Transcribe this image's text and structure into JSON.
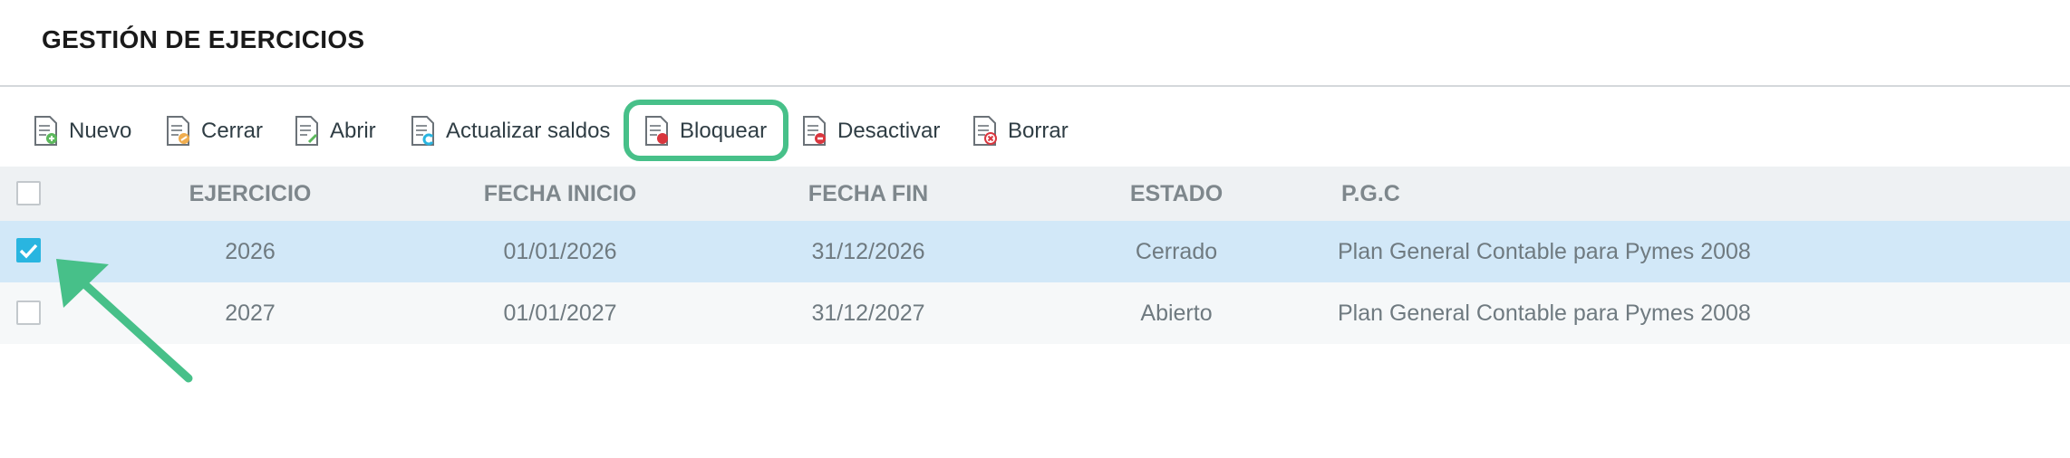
{
  "page_title": "GESTIÓN DE EJERCICIOS",
  "toolbar": {
    "buttons": [
      {
        "label": "Nuevo",
        "icon": "document-add-icon"
      },
      {
        "label": "Cerrar",
        "icon": "document-close-icon"
      },
      {
        "label": "Abrir",
        "icon": "document-open-icon"
      },
      {
        "label": "Actualizar saldos",
        "icon": "document-refresh-icon"
      },
      {
        "label": "Bloquear",
        "icon": "document-lock-icon"
      },
      {
        "label": "Desactivar",
        "icon": "document-deactivate-icon"
      },
      {
        "label": "Borrar",
        "icon": "document-delete-icon"
      }
    ]
  },
  "table": {
    "columns": [
      "EJERCICIO",
      "FECHA INICIO",
      "FECHA FIN",
      "ESTADO",
      "P.G.C"
    ],
    "rows": [
      {
        "selected": true,
        "ejercicio": "2026",
        "fecha_inicio": "01/01/2026",
        "fecha_fin": "31/12/2026",
        "estado": "Cerrado",
        "pgc": "Plan General Contable para Pymes 2008"
      },
      {
        "selected": false,
        "ejercicio": "2027",
        "fecha_inicio": "01/01/2027",
        "fecha_fin": "31/12/2027",
        "estado": "Abierto",
        "pgc": "Plan General Contable para Pymes 2008"
      }
    ]
  },
  "colors": {
    "highlight": "#47c089",
    "selected_row": "#d2e8f8",
    "checkbox_checked": "#29b5e0"
  }
}
